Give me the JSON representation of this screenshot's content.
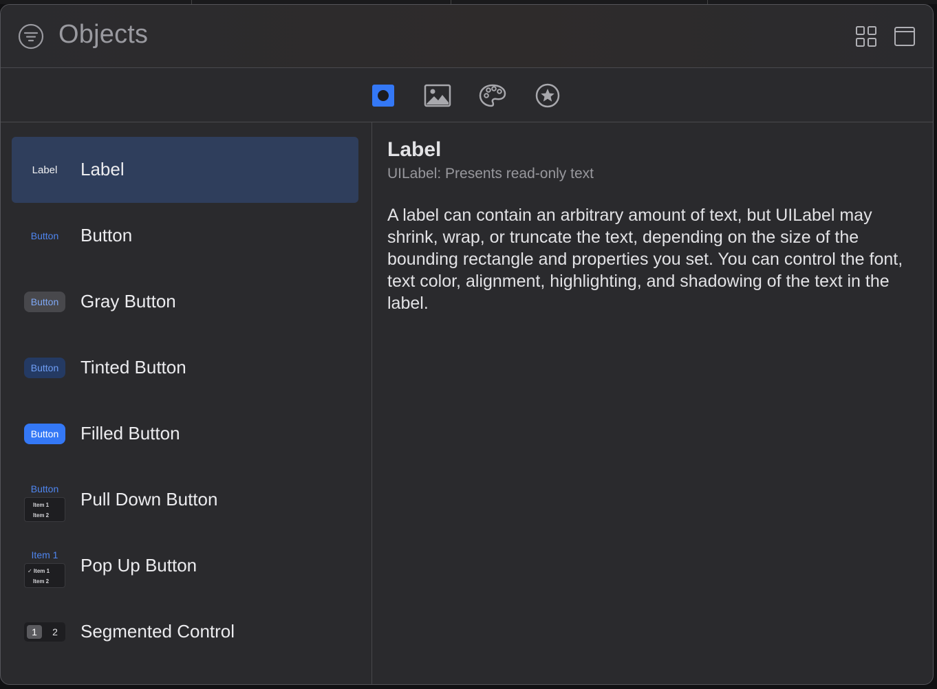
{
  "header": {
    "title": "Objects",
    "filter_icon": "filter-icon",
    "grid_icon": "grid-view-icon",
    "window_icon": "window-icon"
  },
  "tabs": [
    {
      "icon": "objects-icon",
      "active": true
    },
    {
      "icon": "image-icon",
      "active": false
    },
    {
      "icon": "palette-icon",
      "active": false
    },
    {
      "icon": "star-icon",
      "active": false
    }
  ],
  "list": {
    "items": [
      {
        "name": "Label",
        "thumb": "Label"
      },
      {
        "name": "Button",
        "thumb": "Button"
      },
      {
        "name": "Gray Button",
        "thumb": "Button"
      },
      {
        "name": "Tinted Button",
        "thumb": "Button"
      },
      {
        "name": "Filled Button",
        "thumb": "Button"
      },
      {
        "name": "Pull Down Button",
        "thumb": "Button",
        "thumb_items": [
          "Item 1",
          "Item 2"
        ]
      },
      {
        "name": "Pop Up Button",
        "thumb": "Item 1",
        "thumb_items": [
          "✓ Item 1",
          "Item 2"
        ]
      },
      {
        "name": "Segmented Control",
        "thumb_segments": [
          "1",
          "2"
        ]
      }
    ],
    "selected": "Label"
  },
  "detail": {
    "title": "Label",
    "subtitle": "UILabel: Presents read-only text",
    "body": "A label can contain an arbitrary amount of text, but UILabel may shrink, wrap, or truncate the text, depending on the size of the bounding rectangle and properties you set. You can control the font, text color, alignment, highlighting, and shadowing of the text in the label."
  },
  "colors": {
    "accent": "#3478f6",
    "selected_row": "#2f3e5c",
    "background": "#2a2a2d"
  }
}
